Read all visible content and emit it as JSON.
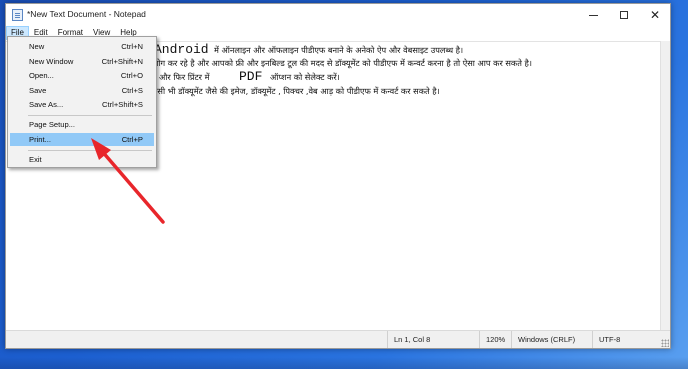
{
  "window": {
    "title": "*New Text Document - Notepad",
    "controls": {
      "minimize": "—",
      "maximize": "☐",
      "close": "✕"
    }
  },
  "menubar": [
    "File",
    "Edit",
    "Format",
    "View",
    "Help"
  ],
  "file_menu": {
    "items": [
      {
        "label": "New",
        "shortcut": "Ctrl+N"
      },
      {
        "label": "New Window",
        "shortcut": "Ctrl+Shift+N"
      },
      {
        "label": "Open...",
        "shortcut": "Ctrl+O"
      },
      {
        "label": "Save",
        "shortcut": "Ctrl+S"
      },
      {
        "label": "Save As...",
        "shortcut": "Ctrl+Shift+S"
      },
      {
        "label": "Page Setup...",
        "shortcut": ""
      },
      {
        "label": "Print...",
        "shortcut": "Ctrl+P"
      },
      {
        "label": "Exit",
        "shortcut": ""
      }
    ],
    "highlighted": "Print..."
  },
  "editor": {
    "line1_big": "Android",
    "line1_rest": "में ऑनलाइन और ऑफलाइन पीडीएफ बनाने के अनेको ऐप और वेबसाइट उपलब्ध है।",
    "line2": "प्रयोग कर रहे है और आपको फ्री और इनबिल्ड टूल की  मदद से डॉक्यूमेंट को पीडीएफ में कन्वर्ट करना  है तो ऐसा आप कर सकते है।",
    "line3_a": "है। और फिर प्रिंटर में",
    "line3_pdf": "PDF",
    "line3_b": "ऑप्शन को सेलेक्ट करें।",
    "line4": "किसी भी डॉक्यूमेंट जैसे की इमेज, डॉक्यूमेंट , पिक्चर ,वेब आड़ को पीडीएफ में कन्वर्ट कर सकते है।"
  },
  "statusbar": {
    "position": "Ln 1, Col 8",
    "zoom": "120%",
    "line_ending": "Windows (CRLF)",
    "encoding": "UTF-8"
  },
  "annotation": {
    "arrow_color": "#e8262b"
  }
}
